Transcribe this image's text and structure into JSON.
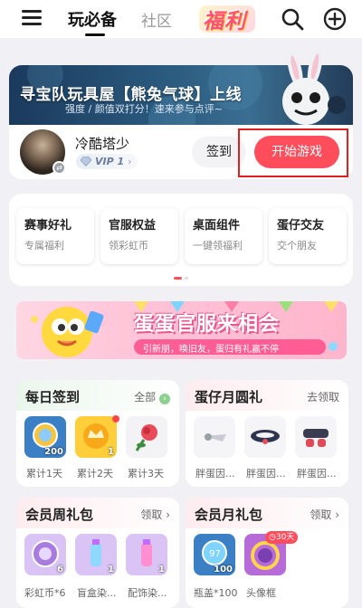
{
  "nav": {
    "tab_active": "玩必备",
    "tab_community": "社区",
    "logo": "福利"
  },
  "banner": {
    "title": "寻宝队玩具屋【熊兔气球】上线",
    "subtitle": "强度 / 颜值双打分！速来参与点评~"
  },
  "user": {
    "name": "冷酷塔少",
    "vip": "VIP 1",
    "signin_label": "签到",
    "start_game_label": "开始游戏"
  },
  "tiles": [
    {
      "title": "赛事好礼",
      "subtitle": "专属福利"
    },
    {
      "title": "官服权益",
      "subtitle": "领彩虹币"
    },
    {
      "title": "桌面组件",
      "subtitle": "一键领福利"
    },
    {
      "title": "蛋仔交友",
      "subtitle": "交个朋友"
    }
  ],
  "promo": {
    "title": "蛋蛋官服来相会",
    "subtitle": "引新朋，唤旧友，蛋归有礼赢不停"
  },
  "daily_signin": {
    "title": "每日签到",
    "link": "全部",
    "items": [
      {
        "count": "200",
        "label": "累计1天"
      },
      {
        "count": "1",
        "label": "累计2天"
      },
      {
        "count": "",
        "label": "累计3天"
      }
    ]
  },
  "monthly_gift": {
    "title": "蛋仔月圆礼",
    "link": "去领取",
    "items": [
      {
        "label": "胖蛋因..."
      },
      {
        "label": "胖蛋因..."
      },
      {
        "label": "胖蛋因..."
      }
    ]
  },
  "weekly_pack": {
    "title": "会员周礼包",
    "link": "领取",
    "items": [
      {
        "count": "6",
        "label": "彩虹币*6"
      },
      {
        "count": "1",
        "label": "盲盒染..."
      },
      {
        "count": "1",
        "label": "配饰染..."
      }
    ]
  },
  "monthly_pack": {
    "title": "会员月礼包",
    "link": "领取",
    "badge": "30天",
    "items": [
      {
        "count": "100",
        "label": "瓶盖*100"
      },
      {
        "count": "",
        "label": "头像框"
      }
    ]
  },
  "colors": {
    "accent": "#ff4d5c",
    "highlight_frame": "#e02020",
    "background": "#f1f1f5"
  }
}
